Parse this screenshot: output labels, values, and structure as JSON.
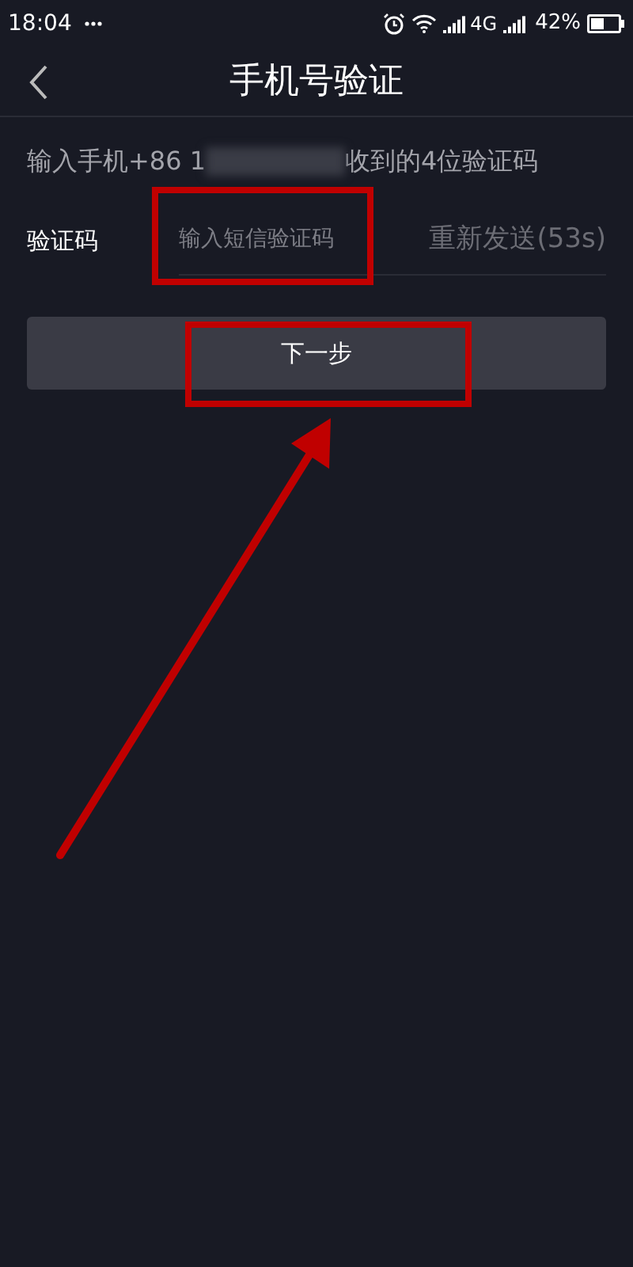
{
  "status_bar": {
    "time": "18:04",
    "network": "4G",
    "battery": "42%"
  },
  "header": {
    "title": "手机号验证"
  },
  "prompt": {
    "start": "输入手机+86 1",
    "end": "收到的4位验证码"
  },
  "code_row": {
    "label": "验证码",
    "placeholder": "输入短信验证码",
    "resend": "重新发送(53s)"
  },
  "next_button": {
    "label": "下一步"
  }
}
